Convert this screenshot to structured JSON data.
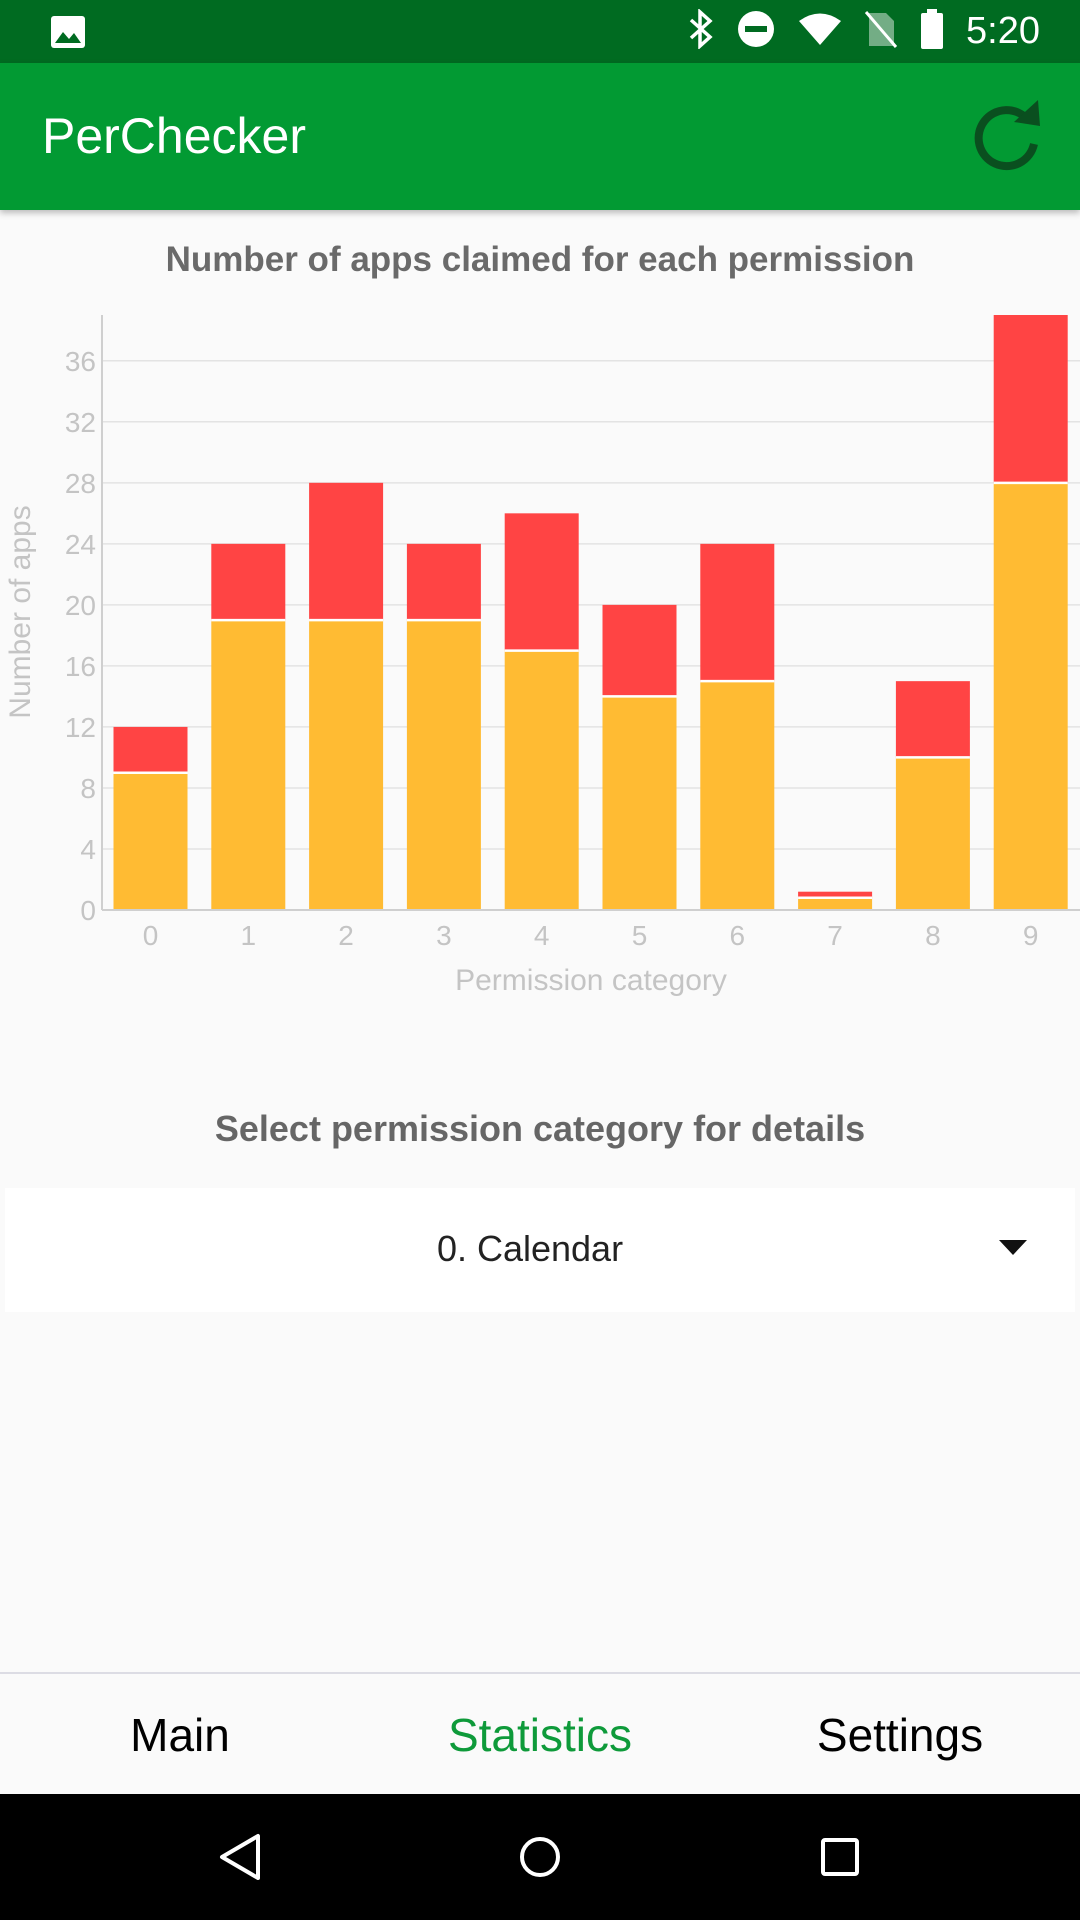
{
  "status_bar": {
    "time": "5:20",
    "icons": [
      "image-icon",
      "bluetooth-icon",
      "do-not-disturb-icon",
      "wifi-icon",
      "no-sim-icon",
      "battery-icon"
    ]
  },
  "app_bar": {
    "title": "PerChecker",
    "refresh_icon": "refresh-icon"
  },
  "chart_data": {
    "type": "bar",
    "stacked": true,
    "title": "Number of apps claimed for each permission",
    "xlabel": "Permission category",
    "ylabel": "Number of apps",
    "categories": [
      "0",
      "1",
      "2",
      "3",
      "4",
      "5",
      "6",
      "7",
      "8",
      "9"
    ],
    "series": [
      {
        "values": [
          9,
          19,
          19,
          19,
          17,
          14,
          15,
          0.8,
          10,
          28
        ],
        "color": "#ffbb33"
      },
      {
        "values": [
          3,
          5,
          9,
          5,
          9,
          6,
          9,
          0.4,
          5,
          11
        ],
        "color": "#ff4444"
      }
    ],
    "yticks": [
      0,
      4,
      8,
      12,
      16,
      20,
      24,
      28,
      32,
      36
    ],
    "ylim": [
      0,
      39
    ],
    "grid": true
  },
  "details": {
    "title": "Select permission category for details",
    "selected": "0. Calendar"
  },
  "bottom_nav": {
    "items": [
      {
        "label": "Main",
        "active": false
      },
      {
        "label": "Statistics",
        "active": true
      },
      {
        "label": "Settings",
        "active": false
      }
    ]
  },
  "colors": {
    "status_bar": "#006b21",
    "app_bar": "#029a33",
    "active_tab": "#0e9a3a"
  }
}
